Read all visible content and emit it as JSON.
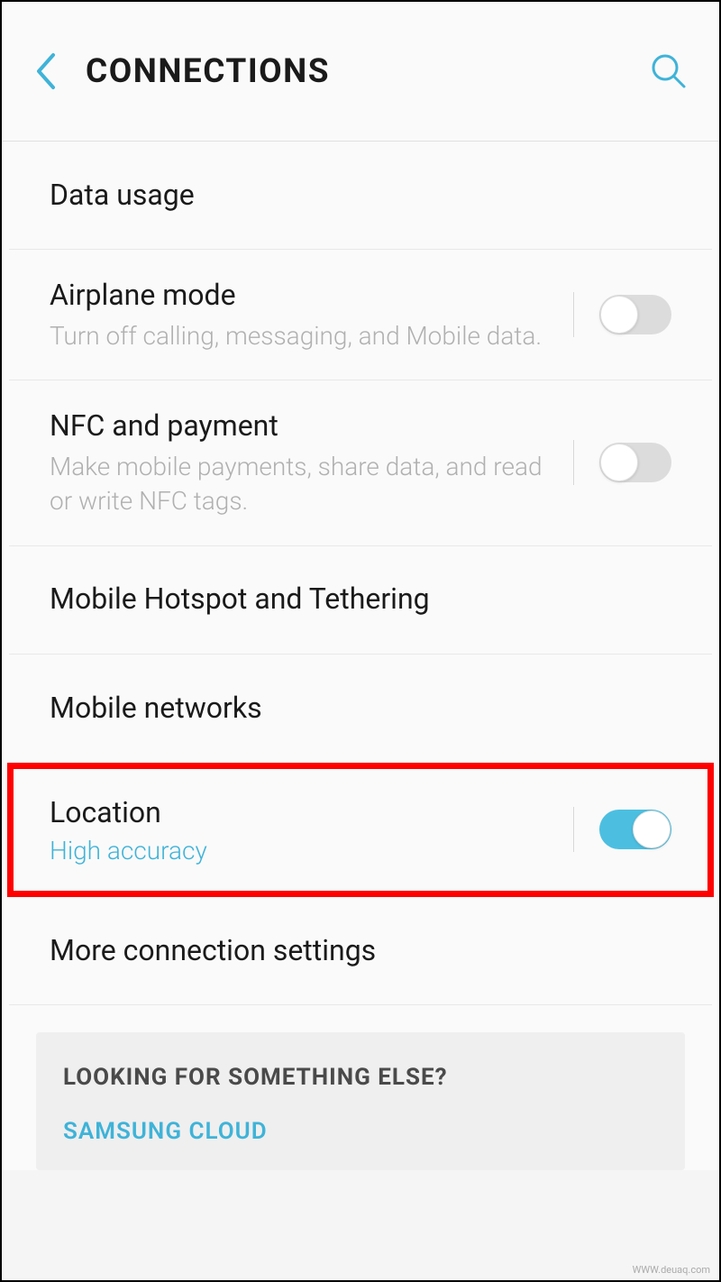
{
  "header": {
    "title": "CONNECTIONS"
  },
  "settings": {
    "data_usage": {
      "title": "Data usage"
    },
    "airplane_mode": {
      "title": "Airplane mode",
      "subtitle": "Turn off calling, messaging, and Mobile data.",
      "toggle": false
    },
    "nfc": {
      "title": "NFC and payment",
      "subtitle": "Make mobile payments, share data, and read or write NFC tags.",
      "toggle": false
    },
    "hotspot": {
      "title": "Mobile Hotspot and Tethering"
    },
    "mobile_networks": {
      "title": "Mobile networks"
    },
    "location": {
      "title": "Location",
      "subtitle": "High accuracy",
      "toggle": true
    },
    "more": {
      "title": "More connection settings"
    }
  },
  "card": {
    "title": "LOOKING FOR SOMETHING ELSE?",
    "link": "SAMSUNG CLOUD"
  },
  "watermark": "WWW.deuaq.com"
}
